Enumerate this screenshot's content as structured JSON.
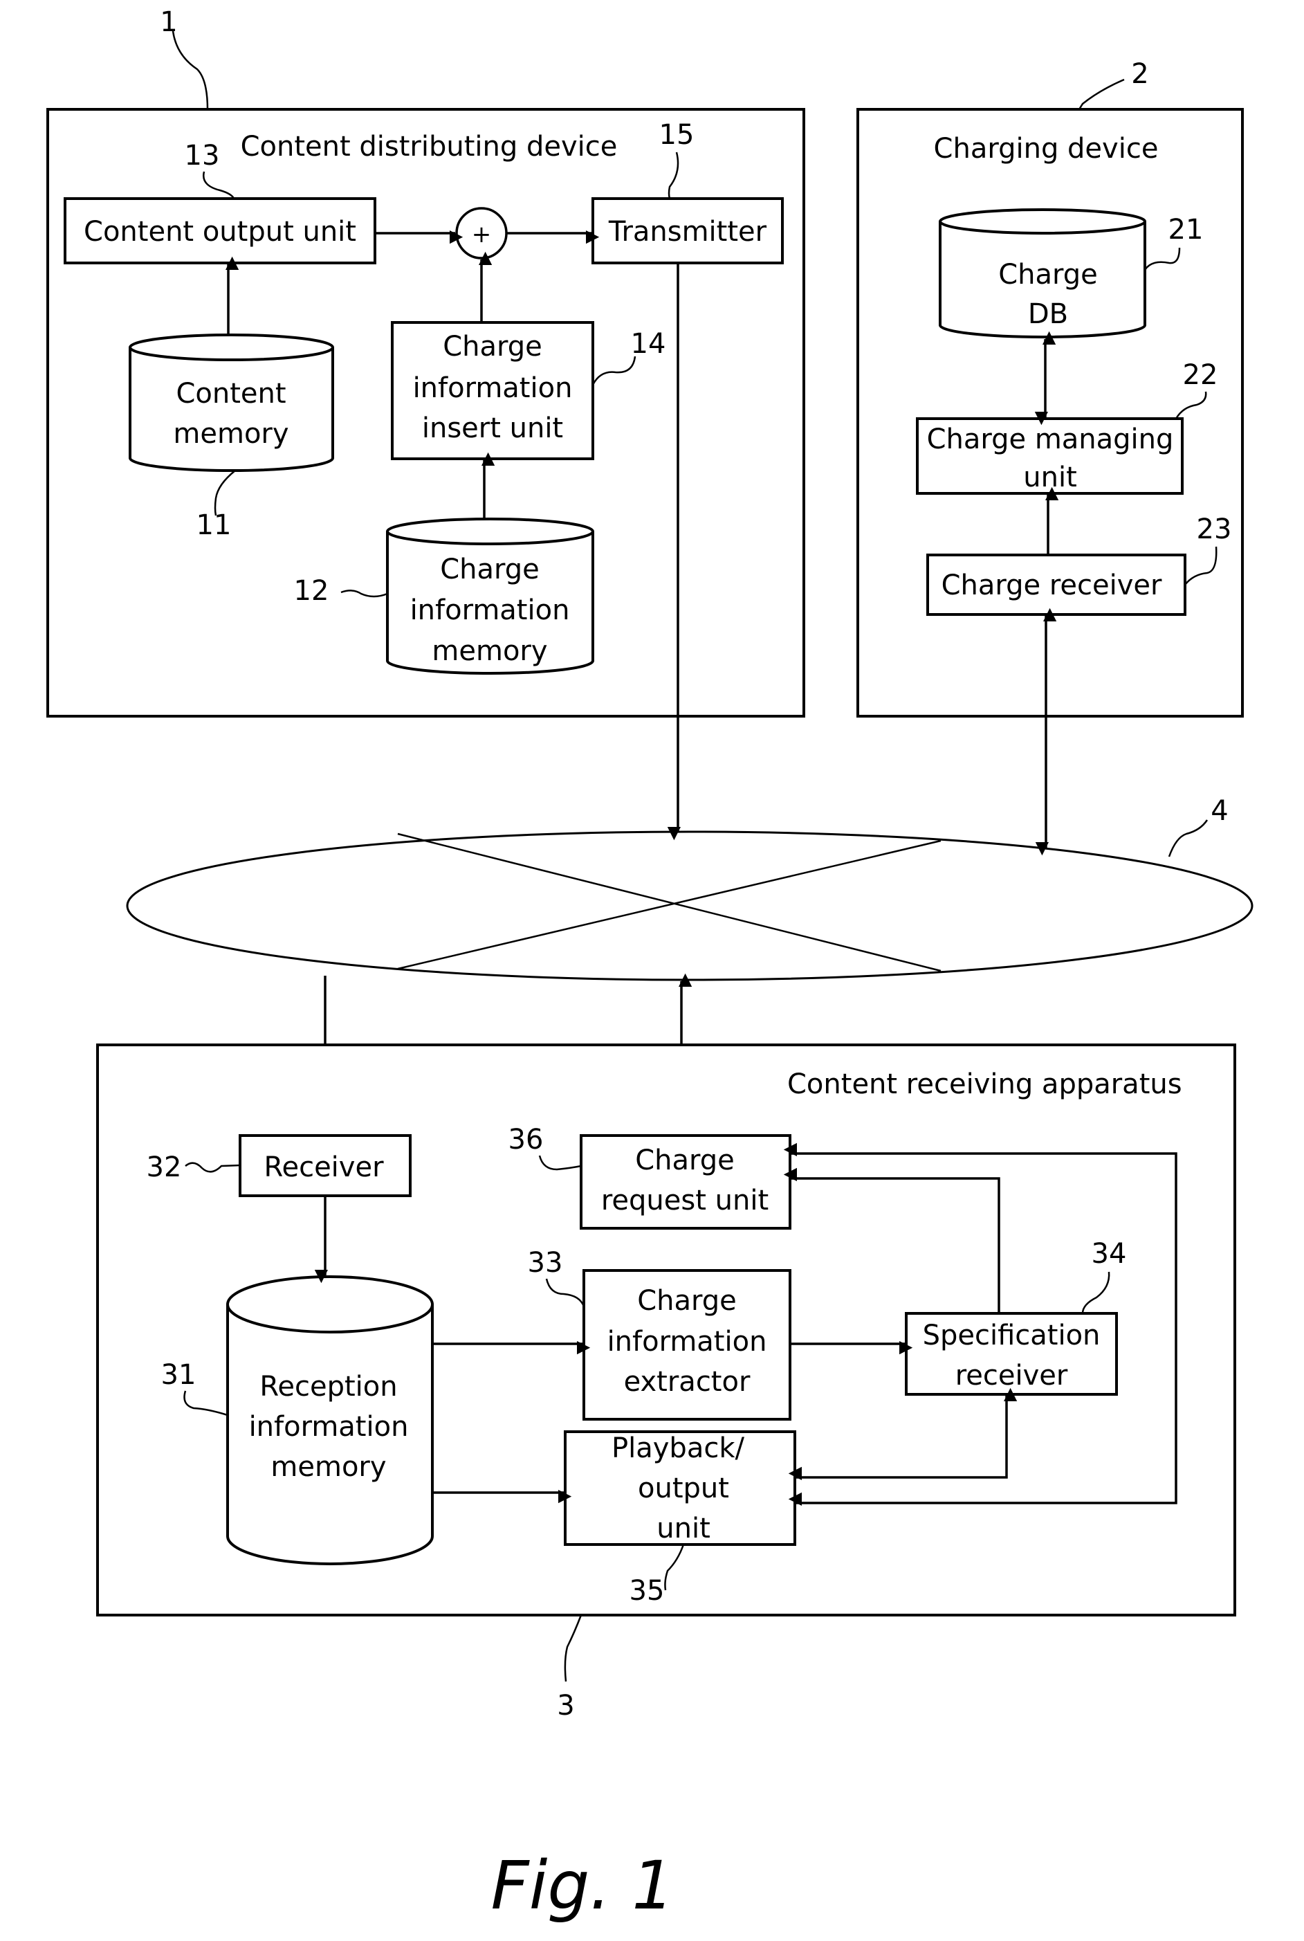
{
  "figure": {
    "caption": "Fig. 1",
    "network": {
      "ref": "4"
    },
    "content_distributing_device": {
      "ref": "1",
      "title": "Content distributing device",
      "content_output_unit": {
        "ref": "13",
        "label": "Content output unit"
      },
      "adder": {
        "symbol": "+"
      },
      "transmitter": {
        "ref": "15",
        "label": "Transmitter"
      },
      "content_memory": {
        "ref": "11",
        "lines": [
          "Content",
          "memory"
        ]
      },
      "charge_information_insert_unit": {
        "ref": "14",
        "lines": [
          "Charge",
          "information",
          "insert unit"
        ]
      },
      "charge_information_memory": {
        "ref": "12",
        "lines": [
          "Charge",
          "information",
          "memory"
        ]
      }
    },
    "charging_device": {
      "ref": "2",
      "title": "Charging device",
      "charge_db": {
        "ref": "21",
        "lines": [
          "Charge",
          "DB"
        ]
      },
      "charge_managing_unit": {
        "ref": "22",
        "lines": [
          "Charge managing",
          "unit"
        ]
      },
      "charge_receiver": {
        "ref": "23",
        "label": "Charge receiver"
      }
    },
    "content_receiving_apparatus": {
      "ref": "3",
      "title": "Content receiving apparatus",
      "receiver": {
        "ref": "32",
        "label": "Receiver"
      },
      "charge_request_unit": {
        "ref": "36",
        "lines": [
          "Charge",
          "request unit"
        ]
      },
      "reception_information_memory": {
        "ref": "31",
        "lines": [
          "Reception",
          "information",
          "memory"
        ]
      },
      "charge_information_extractor": {
        "ref": "33",
        "lines": [
          "Charge",
          "information",
          "extractor"
        ]
      },
      "specification_receiver": {
        "ref": "34",
        "lines": [
          "Specification",
          "receiver"
        ]
      },
      "playback_output_unit": {
        "ref": "35",
        "lines": [
          "Playback/",
          "output",
          "unit"
        ]
      }
    }
  }
}
